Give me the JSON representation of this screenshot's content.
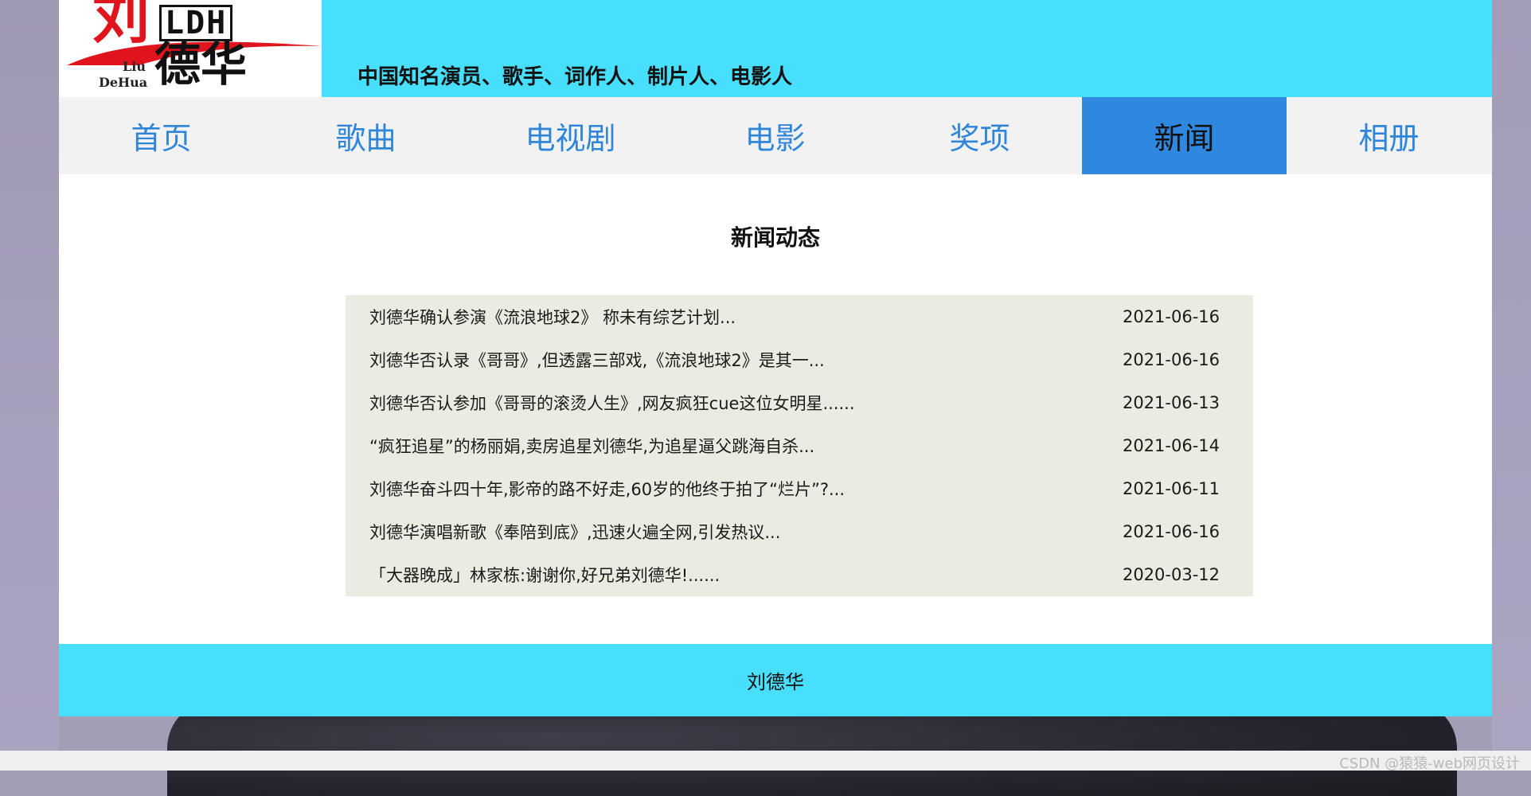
{
  "header": {
    "logo": {
      "liu": "刘",
      "ldh": "LDH",
      "dehua": "德华",
      "en_line1": "Liu",
      "en_line2": "DeHua"
    },
    "tagline": "中国知名演员、歌手、词作人、制片人、电影人"
  },
  "nav": {
    "items": [
      {
        "label": "首页"
      },
      {
        "label": "歌曲"
      },
      {
        "label": "电视剧"
      },
      {
        "label": "电影"
      },
      {
        "label": "奖项"
      },
      {
        "label": "新闻"
      },
      {
        "label": "相册"
      }
    ],
    "active_label": "新闻"
  },
  "main": {
    "title": "新闻动态",
    "news": [
      {
        "title": "刘德华确认参演《流浪地球2》 称未有综艺计划...",
        "date": "2021-06-16"
      },
      {
        "title": "刘德华否认录《哥哥》,但透露三部戏,《流浪地球2》是其一...",
        "date": "2021-06-16"
      },
      {
        "title": "刘德华否认参加《哥哥的滚烫人生》,网友疯狂cue这位女明星......",
        "date": "2021-06-13"
      },
      {
        "title": "“疯狂追星”的杨丽娟,卖房追星刘德华,为追星逼父跳海自杀...",
        "date": "2021-06-14"
      },
      {
        "title": "刘德华奋斗四十年,影帝的路不好走,60岁的他终于拍了“烂片”?...",
        "date": "2021-06-11"
      },
      {
        "title": "刘德华演唱新歌《奉陪到底》,迅速火遍全网,引发热议...",
        "date": "2021-06-16"
      },
      {
        "title": "「大器晚成」林家栋:谢谢你,好兄弟刘德华!......",
        "date": "2020-03-12"
      }
    ]
  },
  "footer": {
    "text": "刘德华"
  },
  "watermark": "CSDN @猿猿-web网页设计",
  "colors": {
    "header_bg": "#48dffc",
    "nav_bg": "#f2f2f3",
    "nav_text": "#2f86d8",
    "nav_active_bg": "#2f88e0",
    "news_bg": "#ecebe1",
    "logo_red": "#e0141c"
  }
}
